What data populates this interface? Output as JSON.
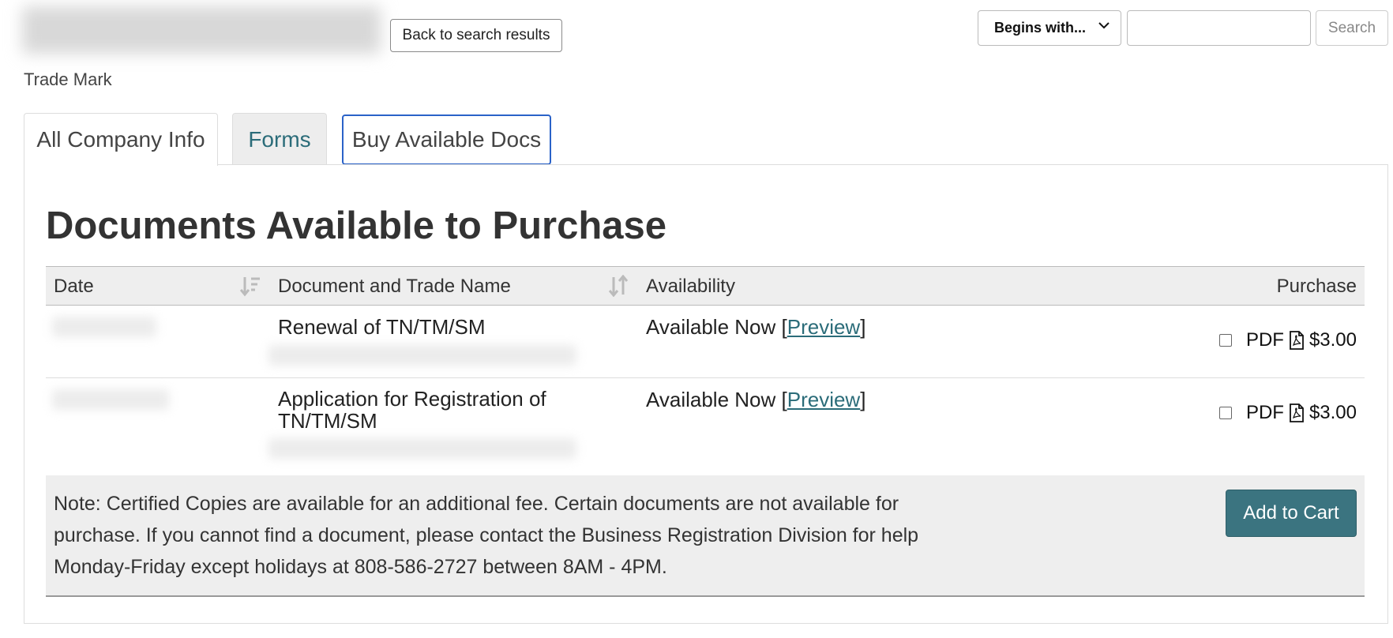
{
  "header": {
    "back_button": "Back to search results",
    "subtitle": "Trade Mark",
    "search_mode": "Begins with...",
    "search_input_value": "",
    "search_button": "Search"
  },
  "tabs": [
    {
      "label": "All Company Info"
    },
    {
      "label": "Forms"
    },
    {
      "label": "Buy Available Docs"
    }
  ],
  "main": {
    "heading": "Documents Available to Purchase",
    "columns": {
      "date": "Date",
      "document": "Document and Trade Name",
      "availability": "Availability",
      "purchase": "Purchase"
    },
    "rows": [
      {
        "document": "Renewal of TN/TM/SM",
        "availability_prefix": "Available Now [",
        "preview": "Preview",
        "availability_suffix": "]",
        "format": "PDF",
        "price": "$3.00"
      },
      {
        "document": "Application for Registration of TN/TM/SM",
        "availability_prefix": "Available Now [",
        "preview": "Preview",
        "availability_suffix": "]",
        "format": "PDF",
        "price": "$3.00"
      }
    ],
    "note": "Note: Certified Copies are available for an additional fee. Certain documents are not available for purchase. If you cannot find a document, please contact the Business Registration Division for help Monday-Friday except holidays at 808-586-2727 between 8AM - 4PM.",
    "add_to_cart": "Add to Cart"
  },
  "colors": {
    "accent": "#3b7480",
    "link": "#2b6c79",
    "focus_ring": "#2a62c8"
  }
}
